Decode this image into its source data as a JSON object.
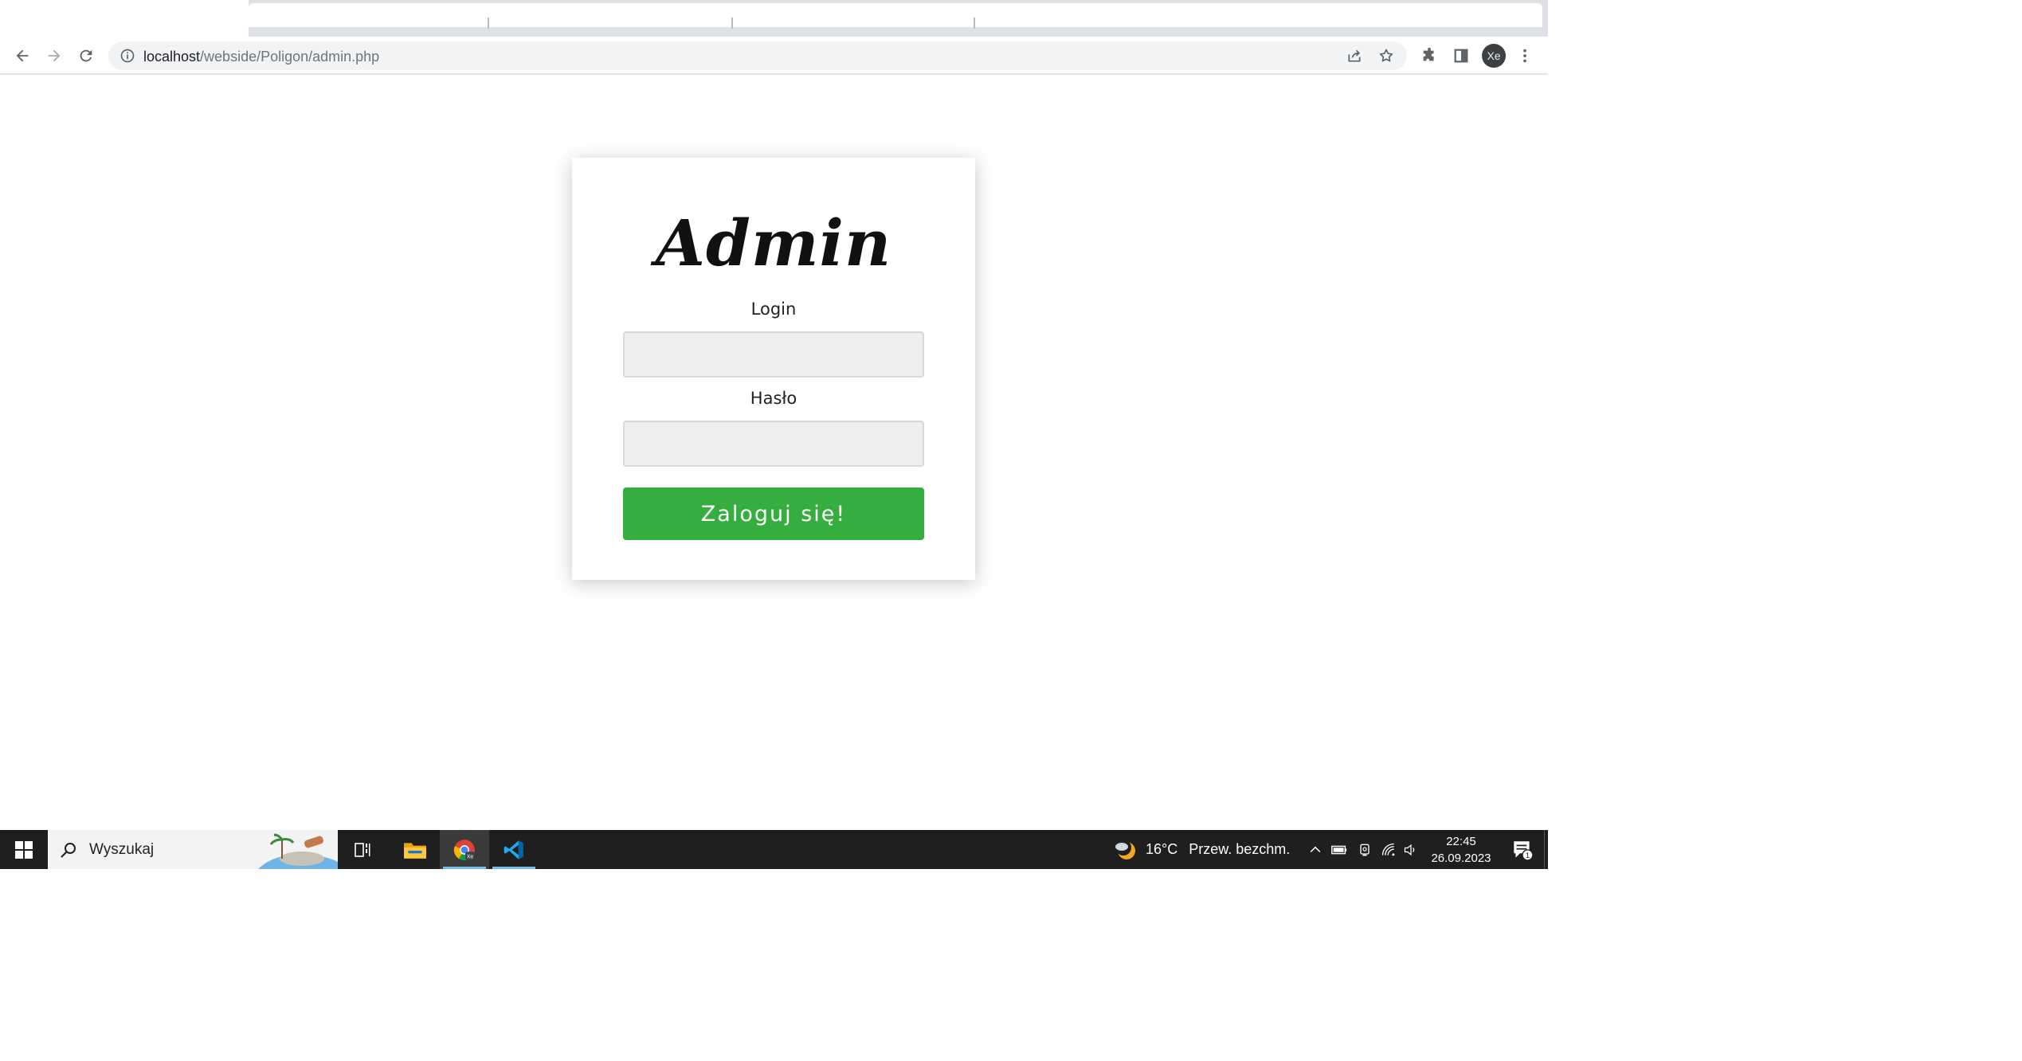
{
  "browser": {
    "url_host": "localhost",
    "url_path": "/webside/Poligon/admin.php",
    "profile_initials": "Xe"
  },
  "page": {
    "title": "Admin",
    "login_label": "Login",
    "password_label": "Hasło",
    "login_value": "",
    "password_value": "",
    "submit_label": "Zaloguj się!",
    "submit_color": "#35ad3f"
  },
  "taskbar": {
    "search_placeholder": "Wyszukaj",
    "apps": [
      "task-view-icon",
      "file-explorer-icon",
      "chrome-icon",
      "vscode-icon"
    ],
    "weather_temp": "16°C",
    "weather_desc": "Przew. bezchm.",
    "time": "22:45",
    "date": "26.09.2023",
    "notification_count": "1"
  }
}
